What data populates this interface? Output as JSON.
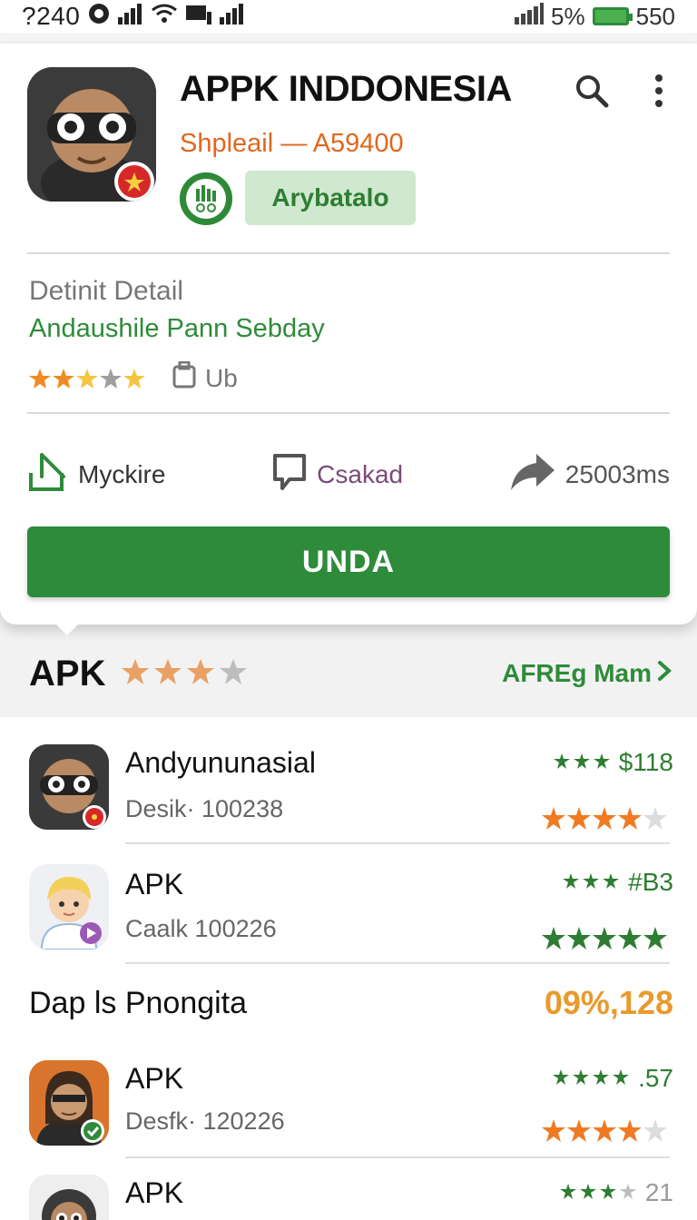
{
  "status_bar": {
    "time": "?240",
    "battery_percent": "5%",
    "right_number": "550"
  },
  "app": {
    "title": "APPK INDDONESIA",
    "subtitle": "Shpleail — A59400",
    "badge_label": "Arybatalo",
    "detail_label": "Detinit Detail",
    "detail_link": "Andaushile Pann Sebday",
    "rating": 3.5,
    "size_label": "Ub",
    "actions": [
      {
        "icon": "download-icon",
        "label": "Myckire",
        "color": "#333333"
      },
      {
        "icon": "comment-icon",
        "label": "Csakad",
        "color": "#7b4a7a"
      },
      {
        "icon": "share-icon",
        "label": "25003ms",
        "color": "#555555"
      }
    ],
    "primary_button": "UNDA"
  },
  "section": {
    "title": "APK",
    "rating": 3,
    "link_label": "AFREg Mam"
  },
  "list": [
    {
      "title": "Andyununasial",
      "subtitle": "Desik· 100238",
      "meta": "$118",
      "stars": 4,
      "star_color": "#f07a22",
      "avatar": "ninja"
    },
    {
      "title": "APK",
      "subtitle": "Caalk  100226",
      "meta": "#B3",
      "stars": 5,
      "star_color": "#2e7d32",
      "avatar": "blond"
    }
  ],
  "promo": {
    "title": "Dap ls Pnongita",
    "value": "09%,128"
  },
  "list2": [
    {
      "title": "APK",
      "subtitle": "Desfk· 120226",
      "meta": ".57",
      "stars": 4,
      "star_color": "#f07a22",
      "avatar": "brown"
    },
    {
      "title": "APK",
      "subtitle": "",
      "meta": "21",
      "stars": 0,
      "star_color": "#f07a22",
      "avatar": "ninja2"
    }
  ],
  "colors": {
    "accent_green": "#2e8b3a",
    "accent_orange": "#e0671f",
    "text_primary": "#111111"
  }
}
